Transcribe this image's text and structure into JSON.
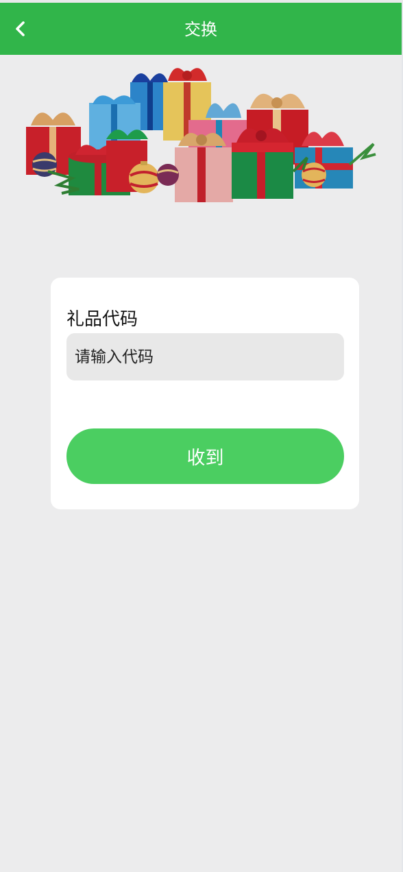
{
  "header": {
    "title": "交换",
    "back_icon": "chevron-left-icon",
    "background_color": "#31b54a"
  },
  "banner": {
    "image": "gift-boxes-illustration"
  },
  "form": {
    "label": "礼品代码",
    "input_placeholder": "请输入代码",
    "input_value": "",
    "submit_label": "收到",
    "submit_color": "#4bce61"
  }
}
